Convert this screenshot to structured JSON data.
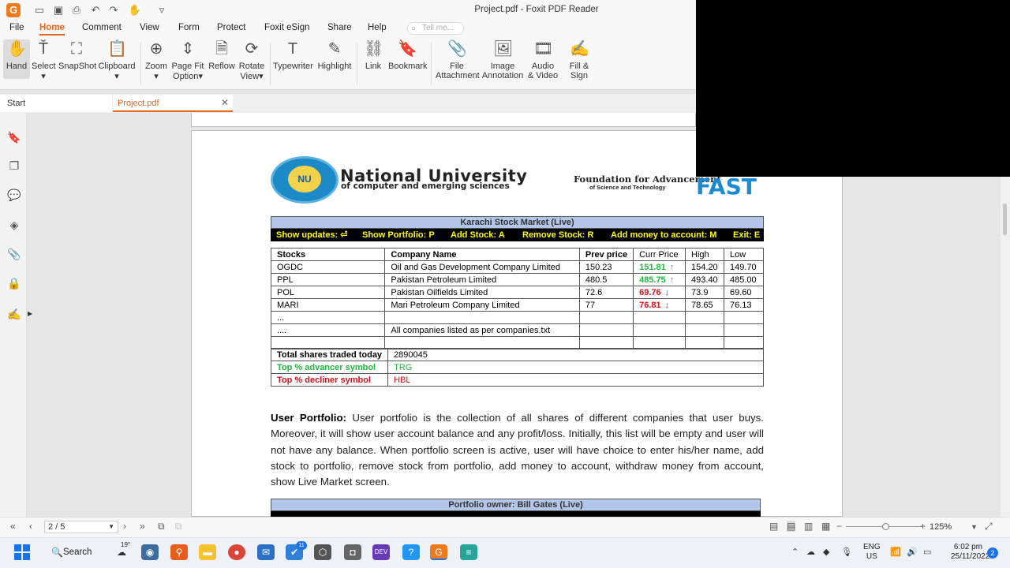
{
  "window": {
    "title": "Project.pdf - Foxit PDF Reader"
  },
  "menu": [
    "File",
    "Home",
    "Comment",
    "View",
    "Form",
    "Protect",
    "Foxit eSign",
    "Share",
    "Help"
  ],
  "tell_me": "Tell me...",
  "ribbon": {
    "hand": "Hand",
    "select": "Select",
    "snapshot": "SnapShot",
    "clipboard": "Clipboard",
    "zoom": "Zoom",
    "page_fit_1": "Page Fit",
    "page_fit_2": "Option",
    "reflow": "Reflow",
    "rotate_1": "Rotate",
    "rotate_2": "View",
    "typewriter": "Typewriter",
    "highlight": "Highlight",
    "link": "Link",
    "bookmark": "Bookmark",
    "file_att_1": "File",
    "file_att_2": "Attachment",
    "image_ann_1": "Image",
    "image_ann_2": "Annotation",
    "audio_1": "Audio",
    "audio_2": "& Video",
    "fill_1": "Fill &",
    "fill_2": "Sign"
  },
  "tabs": {
    "start": "Start",
    "project": "Project.pdf"
  },
  "doc": {
    "nu_title": "National University",
    "nu_sub": "of computer and emerging sciences",
    "nu_seal_text": "NU",
    "fast_title": "Foundation for Advancement",
    "fast_sub": "of Science and Technology",
    "fast_logo": "FAST",
    "market_head": "Karachi Stock Market (Live)",
    "market_bar": [
      "Show updates: ⏎",
      "Show Portfolio: P",
      "Add Stock: A",
      "Remove Stock: R",
      "Add money to account: M",
      "Exit: E"
    ],
    "cols": [
      "Stocks",
      "Company Name",
      "Prev price",
      "Curr Price",
      "High",
      "Low"
    ],
    "rows": [
      {
        "stock": "OGDC",
        "company": "Oil and Gas Development Company Limited",
        "prev": "150.23",
        "curr": "151.81",
        "dir": "up",
        "high": "154.20",
        "low": "149.70"
      },
      {
        "stock": "PPL",
        "company": "Pakistan Petroleum Limited",
        "prev": "480.5",
        "curr": "485.75",
        "dir": "up",
        "high": "493.40",
        "low": "485.00"
      },
      {
        "stock": "POL",
        "company": "Pakistan Oilfields Limited",
        "prev": "72.6",
        "curr": "69.76",
        "dir": "down",
        "high": "73.9",
        "low": "69.60"
      },
      {
        "stock": "MARI",
        "company": "Mari Petroleum Company Limited",
        "prev": "77",
        "curr": "76.81",
        "dir": "down",
        "high": "78.65",
        "low": "76.13"
      },
      {
        "stock": "...",
        "company": "",
        "prev": "",
        "curr": "",
        "dir": "",
        "high": "",
        "low": ""
      },
      {
        "stock": "....",
        "company": "All companies listed as per companies.txt",
        "prev": "",
        "curr": "",
        "dir": "",
        "high": "",
        "low": ""
      },
      {
        "stock": "",
        "company": "",
        "prev": "",
        "curr": "",
        "dir": "",
        "high": "",
        "low": ""
      }
    ],
    "summary": [
      {
        "label": "Total shares traded today",
        "value": "2890045",
        "style": "plain"
      },
      {
        "label": "Top % advancer symbol",
        "value": "TRG",
        "style": "green"
      },
      {
        "label": "Top % decliner symbol",
        "value": "HBL",
        "style": "red"
      }
    ],
    "para_bold": "User Portfolio:",
    "para_text": " User portfolio is the collection of all shares of different companies that user buys. Moreover, it will show user account balance and any profit/loss. Initially, this list will be empty and user will not have any balance. When portfolio screen is active, user will have choice to enter his/her name, add stock to portfolio, remove stock from portfolio, add money to account, withdraw money from account, show Live Market screen.",
    "portfolio_head": "Portfolio owner: Bill Gates (Live)"
  },
  "status": {
    "page": "2 / 5",
    "zoom": "125%"
  },
  "taskbar": {
    "search": "Search",
    "weather": "19°",
    "badge": "11",
    "lang_1": "ENG",
    "lang_2": "US",
    "time": "6:02 pm",
    "date": "25/11/2022",
    "notif": "2"
  }
}
